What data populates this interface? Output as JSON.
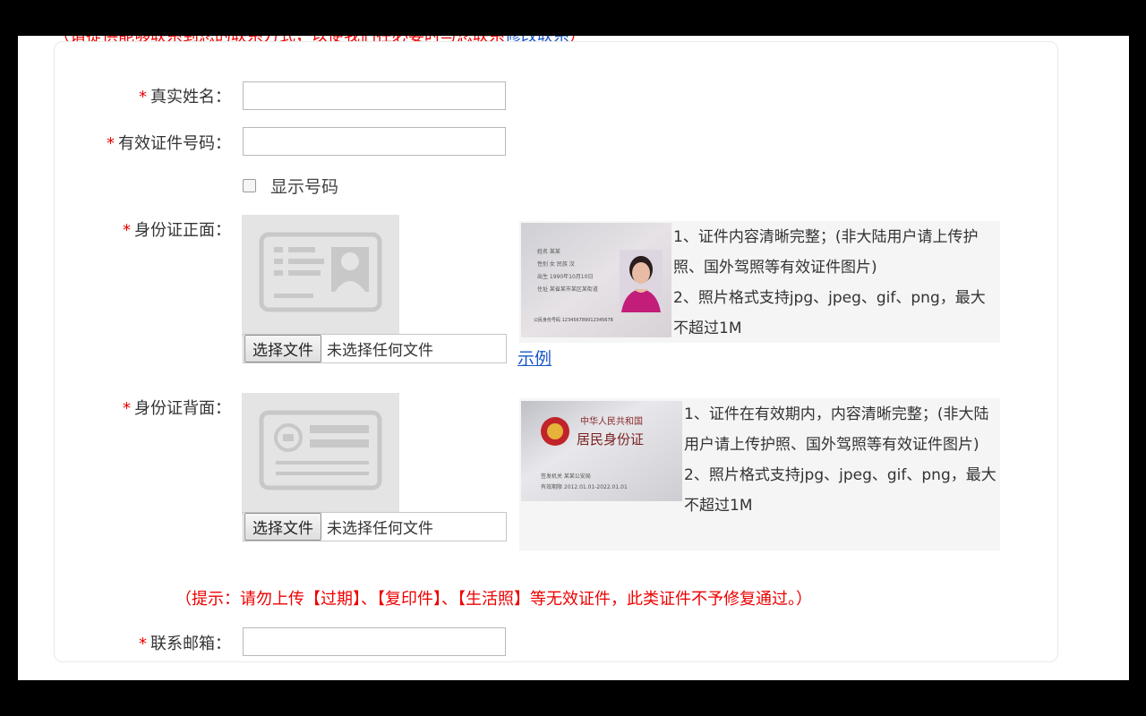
{
  "top_note": {
    "text": "（请提供能够联系到您的联系方式，以便我们在必要时与您联系",
    "link": "修改联系",
    "close": "）"
  },
  "form": {
    "real_name": {
      "star": "*",
      "label": "真实姓名：",
      "value": ""
    },
    "id_number": {
      "star": "*",
      "label": "有效证件号码：",
      "value": ""
    },
    "show_number": {
      "label": "显示号码",
      "checked": false
    },
    "id_front": {
      "star": "*",
      "label": "身份证正面：",
      "choose_button": "选择文件",
      "file_status": "未选择任何文件",
      "tips": [
        "1、证件内容清晰完整；(非大陆用户请上传护照、国外驾照等有效证件图片)",
        "2、照片格式支持jpg、jpeg、gif、png，最大不超过1M"
      ],
      "example_link": "示例"
    },
    "id_back": {
      "star": "*",
      "label": "身份证背面：",
      "choose_button": "选择文件",
      "file_status": "未选择任何文件",
      "tips": [
        "1、证件在有效期内，内容清晰完整；(非大陆用户请上传护照、国外驾照等有效证件图片)",
        "2、照片格式支持jpg、jpeg、gif、png，最大不超过1M"
      ]
    },
    "warning": "（提示：请勿上传【过期】、【复印件】、【生活照】等无效证件，此类证件不予修复通过。）",
    "email": {
      "star": "*",
      "label": "联系邮箱：",
      "value": ""
    }
  },
  "id_card_front_sample": {
    "text": [
      "姓名 某某",
      "性别 女 民族 汉",
      "出生 1990年10月10日",
      "住址 某省某市某区某街道",
      "公民身份号码 123456789012345678"
    ]
  },
  "id_card_back_sample": {
    "text": [
      "中华人民共和国",
      "居民身份证",
      "签发机关 某某公安局",
      "有效期限 2012.01.01-2022.01.01"
    ]
  },
  "colors": {
    "required_star": "#e00000",
    "link": "#1a55c8",
    "warning": "#e00000"
  }
}
